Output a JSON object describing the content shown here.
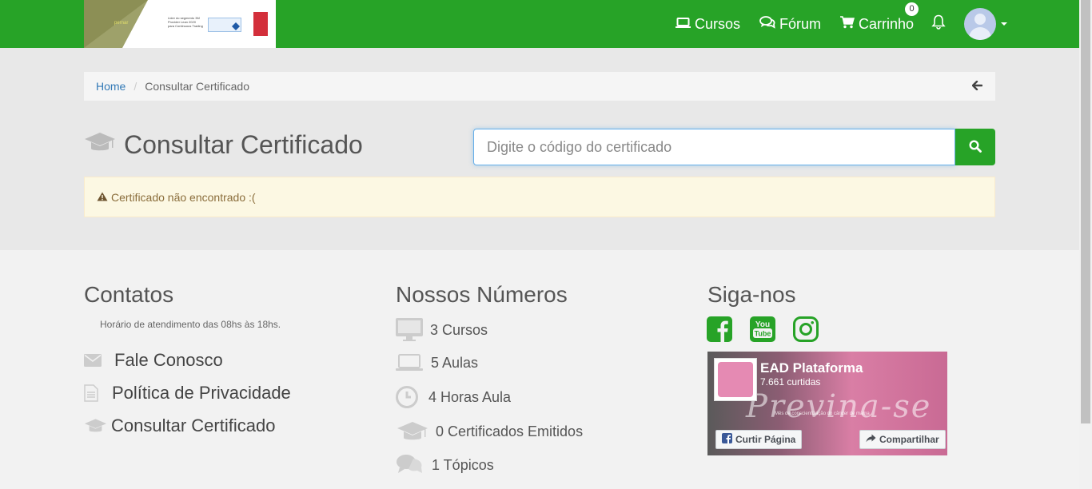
{
  "header": {
    "logo_text": "pernar",
    "logo_badge_text": "Lider do segmento 3M Provider Lean 2020 para Continuous Trading",
    "nav": {
      "cursos": "Cursos",
      "forum": "Fórum",
      "carrinho": "Carrinho",
      "cart_count": "0"
    }
  },
  "breadcrumb": {
    "home": "Home",
    "current": "Consultar Certificado",
    "separator": "/"
  },
  "page": {
    "title": "Consultar Certificado",
    "search_placeholder": "Digite o código do certificado",
    "alert": "Certificado não encontrado :("
  },
  "footer": {
    "contatos": {
      "title": "Contatos",
      "hours": "Horário de atendimento das 08hs às 18hs.",
      "items": [
        "Fale Conosco",
        "Política de Privacidade",
        "Consultar Certificado"
      ]
    },
    "numeros": {
      "title": "Nossos Números",
      "items": [
        "3 Cursos",
        "5 Aulas",
        "4 Horas Aula",
        "0 Certificados Emitidos",
        "1 Tópicos"
      ]
    },
    "siga": {
      "title": "Siga-nos",
      "social": [
        "facebook-icon",
        "youtube-icon",
        "instagram-icon"
      ],
      "fb_page": {
        "name": "EAD Plataforma",
        "likes": "7.661 curtidas",
        "banner_text": "Previna-se",
        "banner_sub": "Mês de conscientização do câncer de mama",
        "like_button": "Curtir Página",
        "share_button": "Compartilhar"
      }
    }
  },
  "colors": {
    "brand_green": "#27a327",
    "alert_bg": "#fcf8e3",
    "alert_text": "#8a6d3b",
    "link_blue": "#337ab7"
  }
}
